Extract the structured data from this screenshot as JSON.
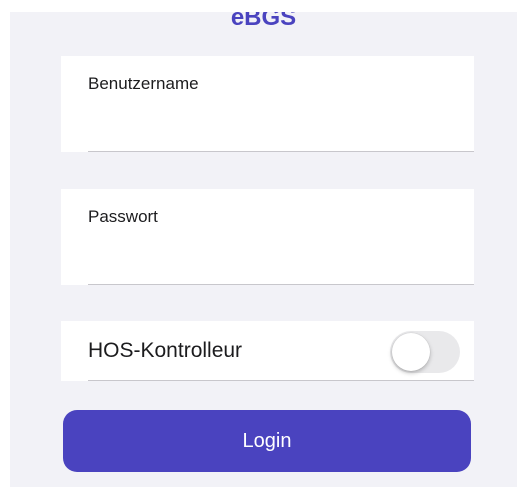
{
  "app": {
    "title": "eBGS"
  },
  "login_form": {
    "username": {
      "label": "Benutzername",
      "value": ""
    },
    "password": {
      "label": "Passwort",
      "value": ""
    },
    "hos_toggle": {
      "label": "HOS-Kontrolleur",
      "state": "off"
    },
    "login_button_label": "Login"
  },
  "colors": {
    "accent": "#4a43bf",
    "background": "#f2f2f7",
    "switch_off": "#e9e9eb"
  }
}
